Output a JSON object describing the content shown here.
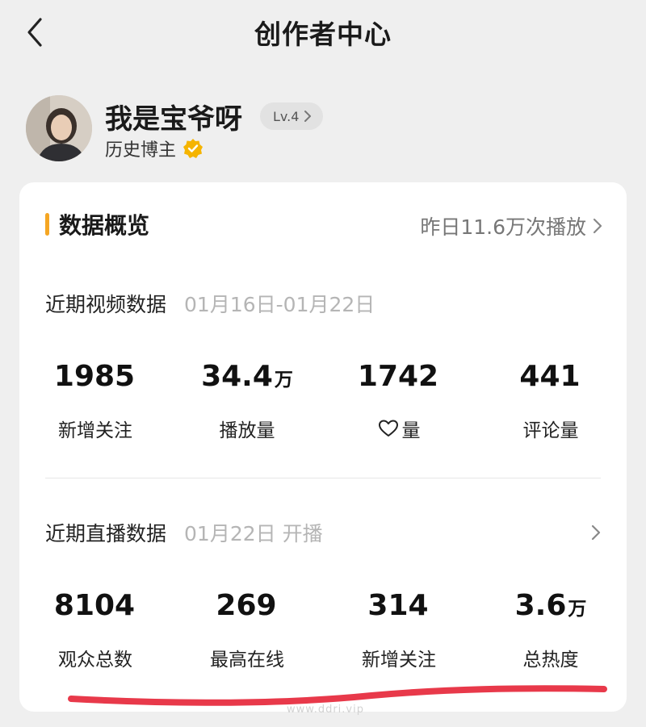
{
  "header": {
    "title": "创作者中心",
    "back_icon": "chevron-left-icon"
  },
  "profile": {
    "name": "我是宝爷呀",
    "level": "Lv.4",
    "subtitle": "历史博主",
    "verified_icon": "verified-badge-icon",
    "verified_color": "#f5b400"
  },
  "overview": {
    "title": "数据概览",
    "accent_color": "#f5a623",
    "summary": "昨日11.6万次播放",
    "video": {
      "title": "近期视频数据",
      "date": "01月16日-01月22日",
      "stats": [
        {
          "value": "1985",
          "unit": "",
          "label": "新增关注"
        },
        {
          "value": "34.4",
          "unit": "万",
          "label": "播放量"
        },
        {
          "value": "1742",
          "unit": "",
          "label": "量",
          "icon": "heart-icon"
        },
        {
          "value": "441",
          "unit": "",
          "label": "评论量"
        }
      ]
    },
    "live": {
      "title": "近期直播数据",
      "date": "01月22日 开播",
      "stats": [
        {
          "value": "8104",
          "unit": "",
          "label": "观众总数"
        },
        {
          "value": "269",
          "unit": "",
          "label": "最高在线"
        },
        {
          "value": "314",
          "unit": "",
          "label": "新增关注"
        },
        {
          "value": "3.6",
          "unit": "万",
          "label": "总热度"
        }
      ]
    }
  },
  "annotation_color": "#e8394a",
  "watermark": "www.ddri.vip"
}
